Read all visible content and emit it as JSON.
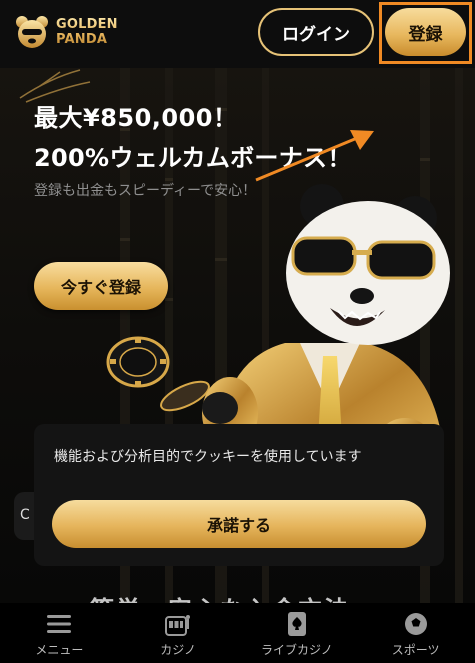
{
  "header": {
    "logo_line1": "GOLDEN",
    "logo_line2": "PANDA",
    "login_label": "ログイン",
    "register_label": "登録"
  },
  "hero": {
    "headline_1": "最大¥850,000！",
    "headline_2": "200%ウェルカムボーナス！",
    "subtext": "登録も出金もスピーディーで安心！",
    "cta_label": "今すぐ登録"
  },
  "cookie_dialog": {
    "message": "機能および分析目的でクッキーを使用しています",
    "accept_label": "承諾する"
  },
  "partial": {
    "input_char": "C",
    "heading_fragment": "簡単　安心な入金方法"
  },
  "bottom_nav": {
    "items": [
      {
        "label": "メニュー",
        "icon": "menu-icon"
      },
      {
        "label": "カジノ",
        "icon": "slot-machine-icon"
      },
      {
        "label": "ライブカジノ",
        "icon": "spade-card-icon"
      },
      {
        "label": "スポーツ",
        "icon": "soccer-ball-icon"
      }
    ]
  },
  "colors": {
    "gold_light": "#f8dd9f",
    "gold_dark": "#c9902f",
    "highlight_orange": "#f08a24",
    "background": "#0d0d0d"
  }
}
